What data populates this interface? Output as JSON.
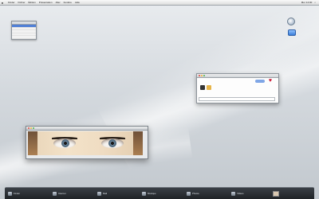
{
  "menubar": {
    "apple": "",
    "menus": [
      "Finder",
      "Fichier",
      "Édition",
      "Présentation",
      "Aller",
      "Fenêtre",
      "Aide"
    ],
    "right": [
      "",
      "Mer 14:00"
    ]
  },
  "palette": {
    "items": [
      "",
      "",
      "",
      "",
      ""
    ]
  },
  "chat_window": {
    "title": "",
    "bubble": "",
    "input_placeholder": ""
  },
  "photo_window": {
    "title": "",
    "status": ""
  },
  "dock": {
    "items": [
      {
        "label": "Finder",
        "icon": "finder-icon"
      },
      {
        "label": "Internet",
        "icon": "globe-icon"
      },
      {
        "label": "Mail",
        "icon": "mail-icon"
      },
      {
        "label": "Musique",
        "icon": "music-icon"
      },
      {
        "label": "Photos",
        "icon": "photos-icon"
      },
      {
        "label": "Vidéos",
        "icon": "video-icon"
      }
    ],
    "right_line1": "",
    "right_line2": ""
  },
  "colors": {
    "accent": "#4f7fd6",
    "dock": "#2a2e33",
    "desktop": "#d4d9de"
  }
}
